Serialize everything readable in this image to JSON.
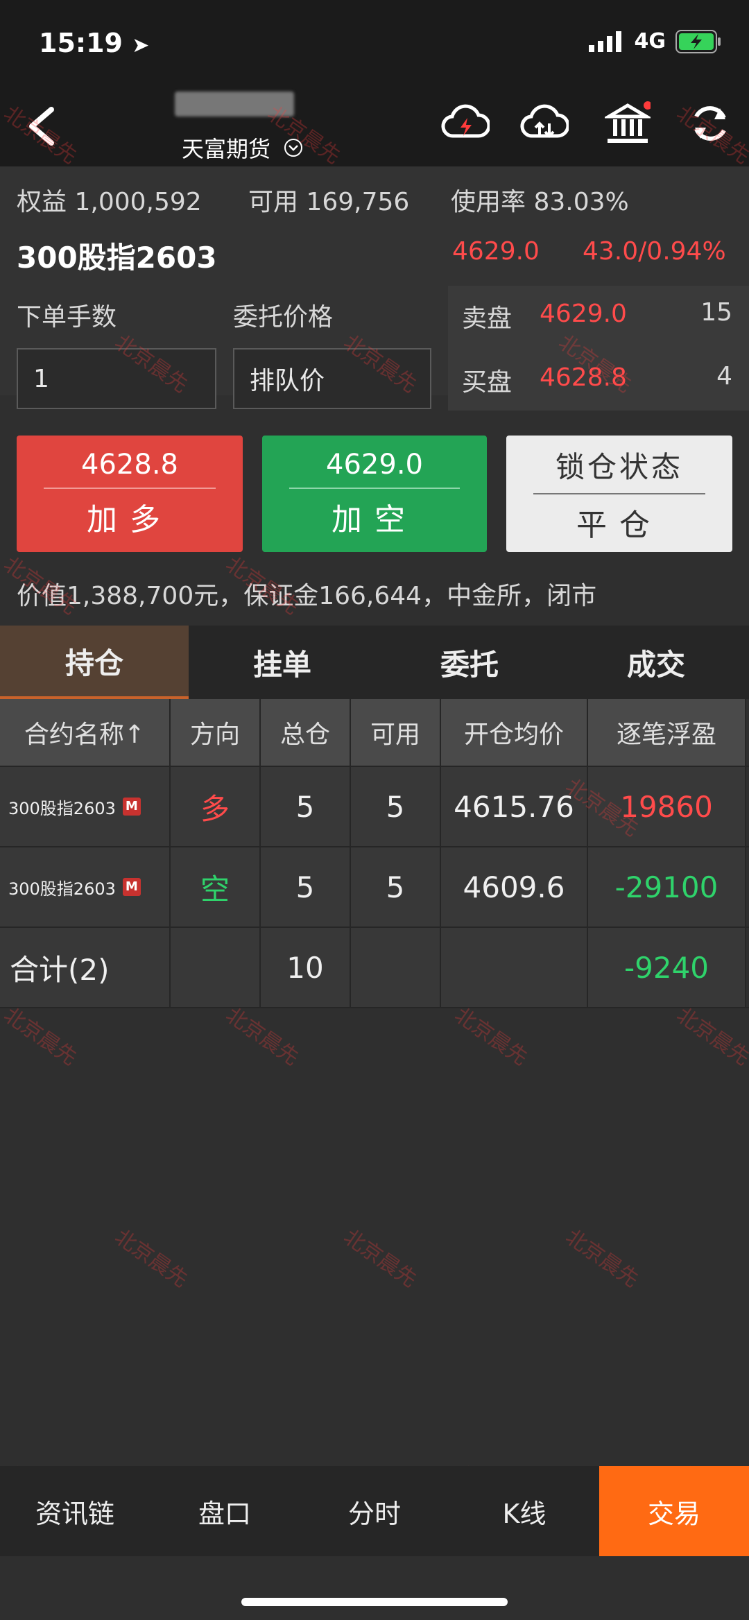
{
  "status_bar": {
    "time": "15:19",
    "network": "4G"
  },
  "nav": {
    "subtitle": "天富期货"
  },
  "account": {
    "equity_label": "权益",
    "equity_value": "1,000,592",
    "available_label": "可用",
    "available_value": "169,756",
    "usage_label": "使用率",
    "usage_value": "83.03%"
  },
  "instrument": {
    "name": "300股指2603",
    "last_price": "4629.0",
    "change": "43.0/0.94%"
  },
  "order": {
    "qty_label": "下单手数",
    "qty_value": "1",
    "price_label": "委托价格",
    "price_value": "排队价"
  },
  "depth": {
    "ask_label": "卖盘",
    "ask_price": "4629.0",
    "ask_qty": "15",
    "bid_label": "买盘",
    "bid_price": "4628.8",
    "bid_qty": "4"
  },
  "buttons": {
    "buy_price": "4628.8",
    "buy_label": "加多",
    "sell_price": "4629.0",
    "sell_label": "加空",
    "lock_label": "锁仓状态",
    "close_label": "平仓"
  },
  "info_line": "价值1,388,700元，保证金166,644，中金所，闭市",
  "tabs": [
    "持仓",
    "挂单",
    "委托",
    "成交"
  ],
  "table": {
    "headers": [
      "合约名称↑",
      "方向",
      "总仓",
      "可用",
      "开仓均价",
      "逐笔浮盈"
    ],
    "rows": [
      {
        "name": "300股指2603",
        "badge": "M",
        "direction": "多",
        "total": "5",
        "available": "5",
        "avg_price": "4615.76",
        "pnl": "19860"
      },
      {
        "name": "300股指2603",
        "badge": "M",
        "direction": "空",
        "total": "5",
        "available": "5",
        "avg_price": "4609.6",
        "pnl": "-29100"
      }
    ],
    "summary": {
      "label": "合计(2)",
      "total": "10",
      "pnl": "-9240"
    }
  },
  "bottom_nav": [
    "资讯链",
    "盘口",
    "分时",
    "K线",
    "交易"
  ],
  "watermark": "北京晨先",
  "colors": {
    "up": "#ff4b4b",
    "down": "#2fd36b",
    "accent": "#ff6a13",
    "buy_btn": "#e0453f",
    "sell_btn": "#23a455"
  }
}
